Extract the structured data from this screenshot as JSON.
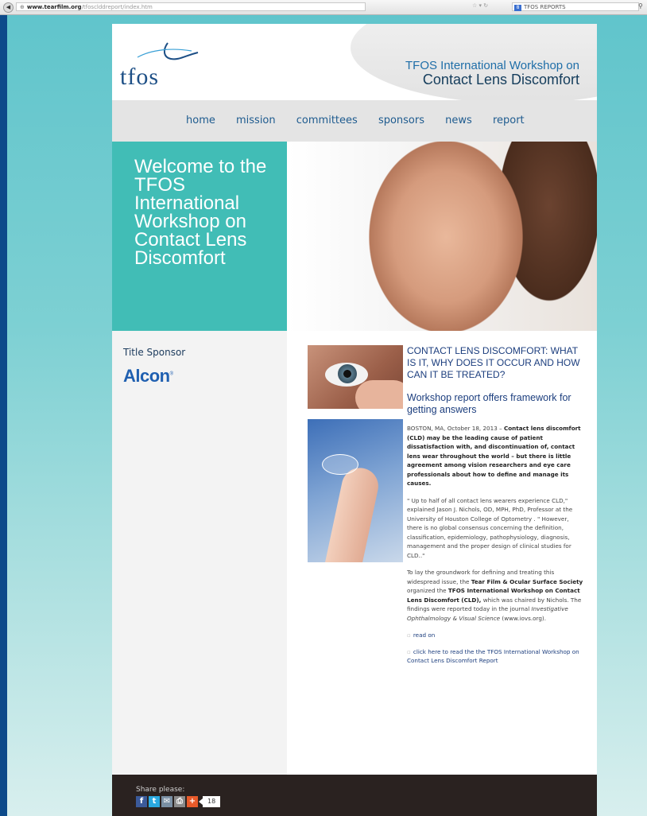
{
  "browser": {
    "url_domain": "www.tearfilm.org",
    "url_path": "/tfosclddreport/index.htm",
    "search_engine_label": "TFOS REPORTS"
  },
  "header": {
    "logo_text": "tfos",
    "title_line1": "TFOS International Workshop on",
    "title_line2": "Contact Lens Discomfort"
  },
  "nav": {
    "items": [
      "home",
      "mission",
      "committees",
      "sponsors",
      "news",
      "report"
    ]
  },
  "welcome": {
    "text": "Welcome to the TFOS International Workshop on Contact Lens Discomfort"
  },
  "sidebar": {
    "sponsor_label": "Title Sponsor",
    "sponsor_name": "Alcon",
    "sponsor_mark": "®"
  },
  "article": {
    "headline": "CONTACT LENS DISCOMFORT: WHAT IS IT, WHY DOES IT OCCUR AND HOW CAN IT BE TREATED?",
    "subhead": "Workshop report offers framework for getting answers",
    "p1_lead": "BOSTON, MA, October 18, 2013 – ",
    "p1_bold": "Contact lens discomfort (CLD) may be the leading cause of patient dissatisfaction with, and discontinuation of, contact lens wear throughout the world – but there is little agreement among vision researchers and eye care professionals about how to define and manage its causes.",
    "p2": "\" Up to half of all contact lens wearers experience CLD,\" explained Jason J. Nichols, OD, MPH, PhD, Professor at the University of Houston College of Optometry . \" However, there is no global consensus concerning the definition, classification, epidemiology, pathophysiology, diagnosis, management and the proper design of clinical studies for CLD..\"",
    "p3_a": "To lay the groundwork for defining and treating this widespread issue, the ",
    "p3_b": "Tear Film & Ocular Surface Society",
    "p3_c": " organized the ",
    "p3_d": "TFOS International Workshop on Contact Lens Discomfort (CLD),",
    "p3_e": " which was chaired by Nichols. The findings were reported today in the journal ",
    "p3_f": "Investigative Ophthalmology & Visual Science",
    "p3_g": " (www.iovs.org).",
    "read_on": "read on",
    "report_link": "click here to read the the TFOS International Workshop on Contact Lens Discomfort Report"
  },
  "footer": {
    "share_label": "Share please:",
    "share_count": "18"
  }
}
